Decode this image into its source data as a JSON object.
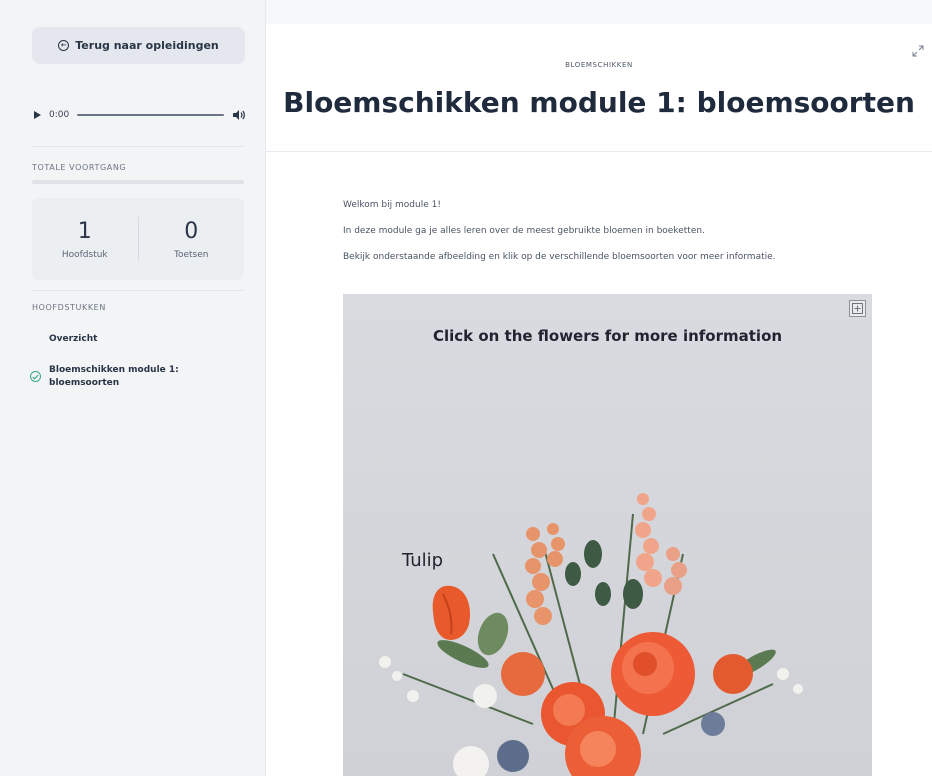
{
  "sidebar": {
    "back_label": "Terug naar opleidingen",
    "audio": {
      "time": "0:00",
      "progress": 0
    },
    "progress_label": "TOTALE VOORTGANG",
    "progress_value": 0,
    "stats": [
      {
        "value": "1",
        "label": "Hoofdstuk"
      },
      {
        "value": "0",
        "label": "Toetsen"
      }
    ],
    "chapters_label": "HOOFDSTUKKEN",
    "chapters": [
      {
        "line1": "Overzicht",
        "line2": "",
        "completed": false
      },
      {
        "line1": "Bloemschikken module 1:",
        "line2": "bloemsoorten",
        "completed": true
      }
    ]
  },
  "header": {
    "kicker": "BLOEMSCHIKKEN",
    "title": "Bloemschikken module 1: bloemsoorten"
  },
  "content": {
    "paragraphs": [
      "Welkom bij module 1!",
      "In deze module ga je alles leren over de meest gebruikte bloemen in boeketten.",
      "Bekijk onderstaande afbeelding en klik op de verschillende bloemsoorten voor meer informatie."
    ]
  },
  "interactive": {
    "prompt": "Click on the flowers for more information",
    "hotspot_label": "Tulip"
  },
  "colors": {
    "accent": "#3aa986",
    "sidebar_bg": "#f2f4f6",
    "title": "#1f2a3c"
  }
}
